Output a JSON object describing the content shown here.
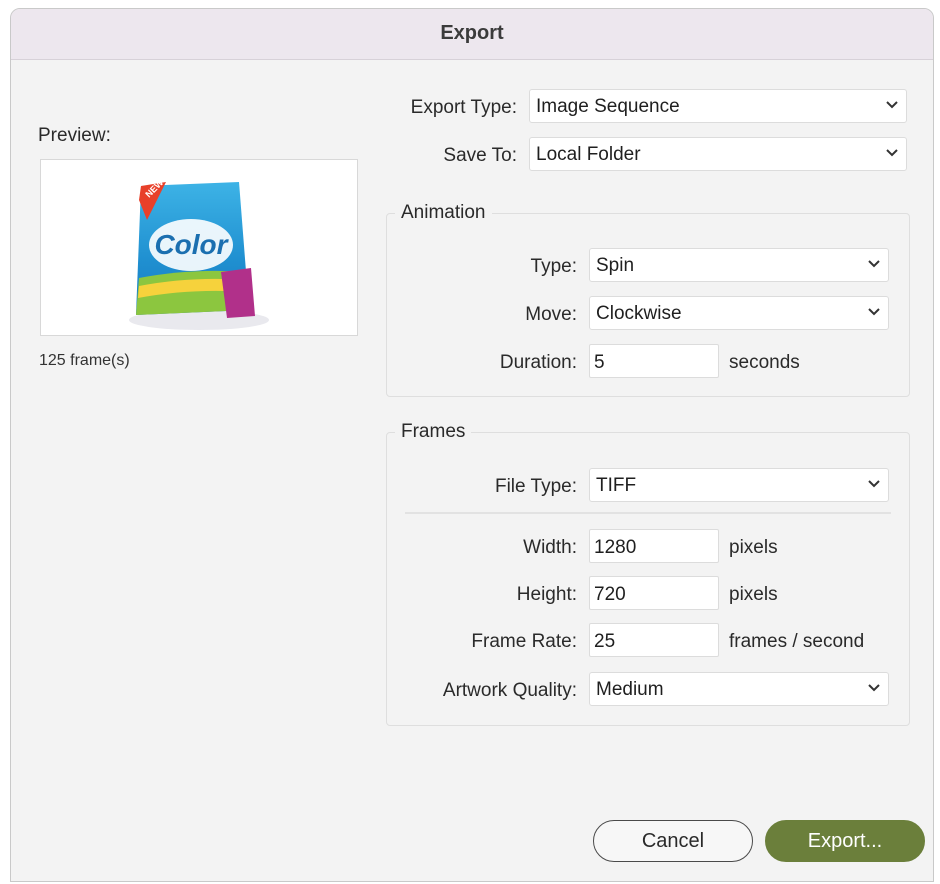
{
  "window": {
    "title": "Export"
  },
  "preview": {
    "label": "Preview:",
    "frames": "125 frame(s)",
    "product_text": "Color",
    "badge_text": "NEW"
  },
  "export_type": {
    "label": "Export Type:",
    "value": "Image Sequence"
  },
  "save_to": {
    "label": "Save To:",
    "value": "Local Folder"
  },
  "animation": {
    "title": "Animation",
    "type": {
      "label": "Type:",
      "value": "Spin"
    },
    "move": {
      "label": "Move:",
      "value": "Clockwise"
    },
    "duration": {
      "label": "Duration:",
      "value": "5",
      "unit": "seconds"
    }
  },
  "frames": {
    "title": "Frames",
    "file_type": {
      "label": "File Type:",
      "value": "TIFF"
    },
    "width": {
      "label": "Width:",
      "value": "1280",
      "unit": "pixels"
    },
    "height": {
      "label": "Height:",
      "value": "720",
      "unit": "pixels"
    },
    "frame_rate": {
      "label": "Frame Rate:",
      "value": "25",
      "unit": "frames / second"
    },
    "artwork_quality": {
      "label": "Artwork Quality:",
      "value": "Medium"
    }
  },
  "buttons": {
    "cancel": "Cancel",
    "export": "Export..."
  },
  "colors": {
    "accent": "#6b7f3b",
    "titlebar": "#ede7ee"
  },
  "icons": {
    "dropdown": "chevron-down-icon"
  }
}
